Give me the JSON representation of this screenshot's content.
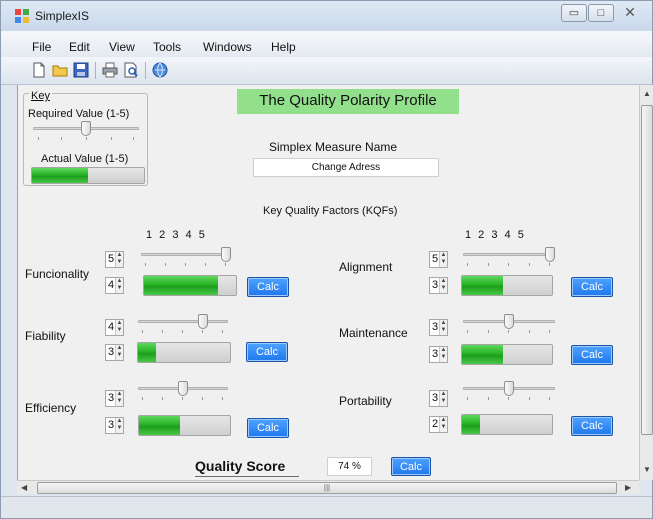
{
  "window": {
    "title": "SimplexIS"
  },
  "menu": {
    "items": [
      "File",
      "Edit",
      "View",
      "Tools",
      "Windows",
      "Help"
    ]
  },
  "toolbar": {
    "icons": [
      "new-file-icon",
      "open-folder-icon",
      "save-icon",
      "print-icon",
      "print-preview-icon",
      "refresh-globe-icon"
    ]
  },
  "key": {
    "title": "Key",
    "required_label": "Required Value (1-5)",
    "actual_label": "Actual Value (1-5)",
    "required_value": 3,
    "actual_fraction": 0.5
  },
  "header": {
    "title": "The Quality Polarity Profile"
  },
  "measure": {
    "label": "Simplex Measure Name",
    "value": "Change Adress"
  },
  "kqf": {
    "heading": "Key Quality Factors (KQFs)",
    "scale_numbers": "1  2  3  4  5",
    "calc_label": "Calc",
    "factors": [
      {
        "name": "Funcionality",
        "required": "5",
        "actual": "4",
        "required_value": 5,
        "actual_fraction": 0.8
      },
      {
        "name": "Fiability",
        "required": "4",
        "actual": "3",
        "required_value": 4,
        "actual_fraction": 0.2
      },
      {
        "name": "Efficiency",
        "required": "3",
        "actual": "3",
        "required_value": 3,
        "actual_fraction": 0.45
      },
      {
        "name": "Alignment",
        "required": "5",
        "actual": "3",
        "required_value": 5,
        "actual_fraction": 0.45
      },
      {
        "name": "Maintenance",
        "required": "3",
        "actual": "3",
        "required_value": 3,
        "actual_fraction": 0.45
      },
      {
        "name": "Portability",
        "required": "3",
        "actual": "2",
        "required_value": 3,
        "actual_fraction": 0.2
      }
    ]
  },
  "score": {
    "label": "Quality Score",
    "value": "74 %",
    "calc_label": "Calc"
  },
  "colors": {
    "title_bg": "#93e08c",
    "progress_green": "#27b326",
    "calc_blue": "#1f77ec"
  }
}
